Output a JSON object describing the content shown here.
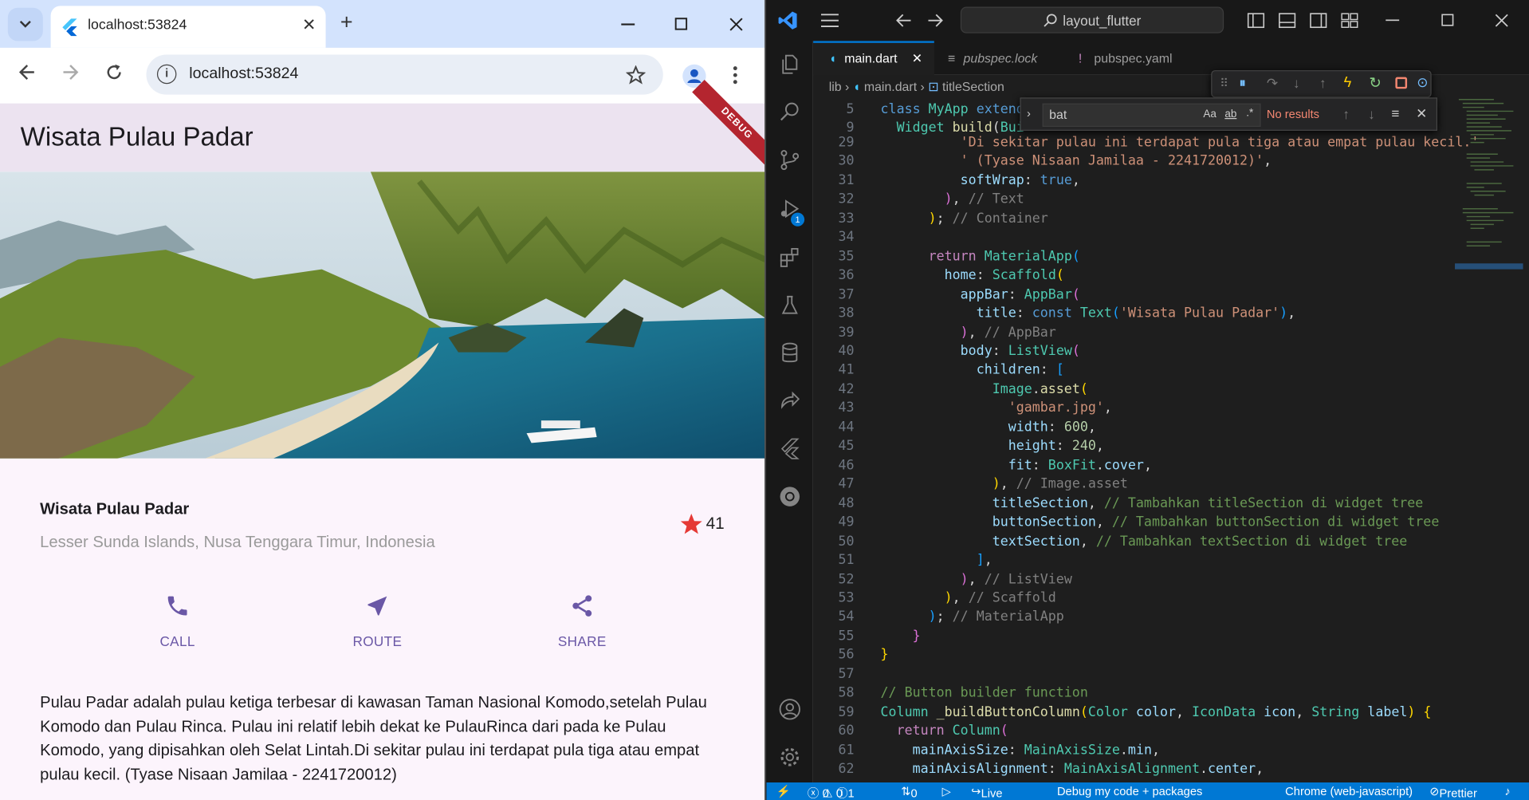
{
  "browser": {
    "tab_title": "localhost:53824",
    "url": "localhost:53824",
    "new_tab": "+",
    "close_tab": "✕"
  },
  "app": {
    "appbar_title": "Wisata Pulau Padar",
    "debug_banner": "DEBUG",
    "place_title": "Wisata Pulau Padar",
    "place_location": "Lesser Sunda Islands, Nusa Tenggara Timur, Indonesia",
    "rating": "41",
    "buttons": [
      {
        "label": "CALL",
        "icon": "phone-icon"
      },
      {
        "label": "ROUTE",
        "icon": "navigation-icon"
      },
      {
        "label": "SHARE",
        "icon": "share-icon"
      }
    ],
    "description": "Pulau Padar adalah pulau ketiga terbesar di kawasan Taman Nasional Komodo,setelah Pulau Komodo dan Pulau Rinca. Pulau ini relatif lebih dekat ke PulauRinca dari pada ke Pulau Komodo, yang dipisahkan oleh Selat Lintah.Di sekitar pulau ini terdapat pula tiga atau empat pulau kecil. (Tyase Nisaan Jamilaa - 2241720012)",
    "accent_color": "#6a57a6",
    "star_color": "#e53935"
  },
  "vscode": {
    "search": "layout_flutter",
    "tabs": [
      {
        "label": "main.dart",
        "active": true
      },
      {
        "label": "pubspec.lock",
        "active": false
      },
      {
        "label": "pubspec.yaml",
        "active": false
      }
    ],
    "breadcrumb": [
      "lib",
      "main.dart",
      "titleSection"
    ],
    "find_query": "bat",
    "find_result": "No results",
    "find_options": [
      "Aa",
      "ab",
      ".*"
    ],
    "status": {
      "errors": "0",
      "warnings": "0",
      "info": "1",
      "ports": "0",
      "live_share": "Live Share",
      "debug_target": "Debug my code + packages",
      "device": "Chrome (web-javascript)",
      "prettier": "Prettier"
    },
    "activity_badge": "1"
  }
}
